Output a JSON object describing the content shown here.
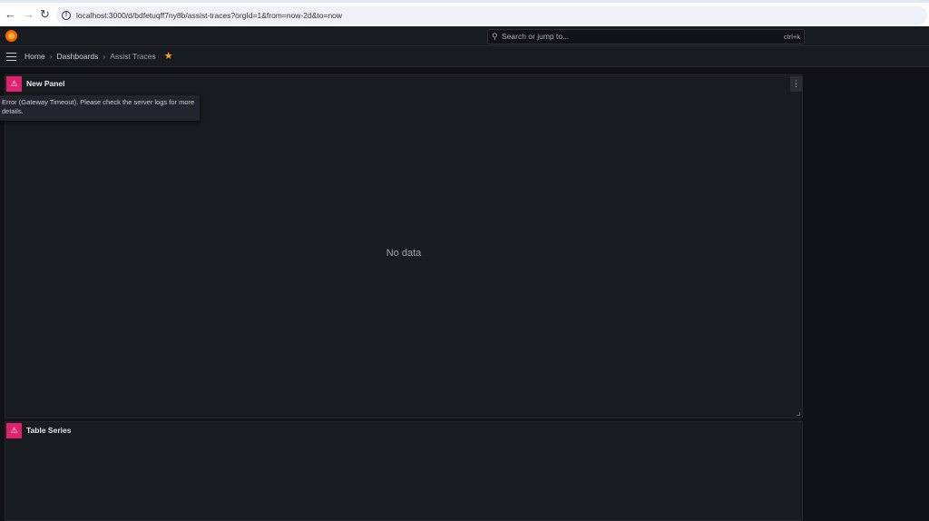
{
  "browser": {
    "url": "localhost:3000/d/bdfetuqff7ny8b/assist-traces?orgId=1&from=now-2d&to=now"
  },
  "topbar": {
    "search_placeholder": "Search or jump to...",
    "shortcut": "ctrl+k"
  },
  "breadcrumb": {
    "items": [
      "Home",
      "Dashboards",
      "Assist Traces"
    ]
  },
  "panels": [
    {
      "title": "New Panel",
      "message": "No data",
      "error": "Error (Gateway Timeout). Please check the server logs for more details."
    },
    {
      "title": "Table Series"
    }
  ]
}
